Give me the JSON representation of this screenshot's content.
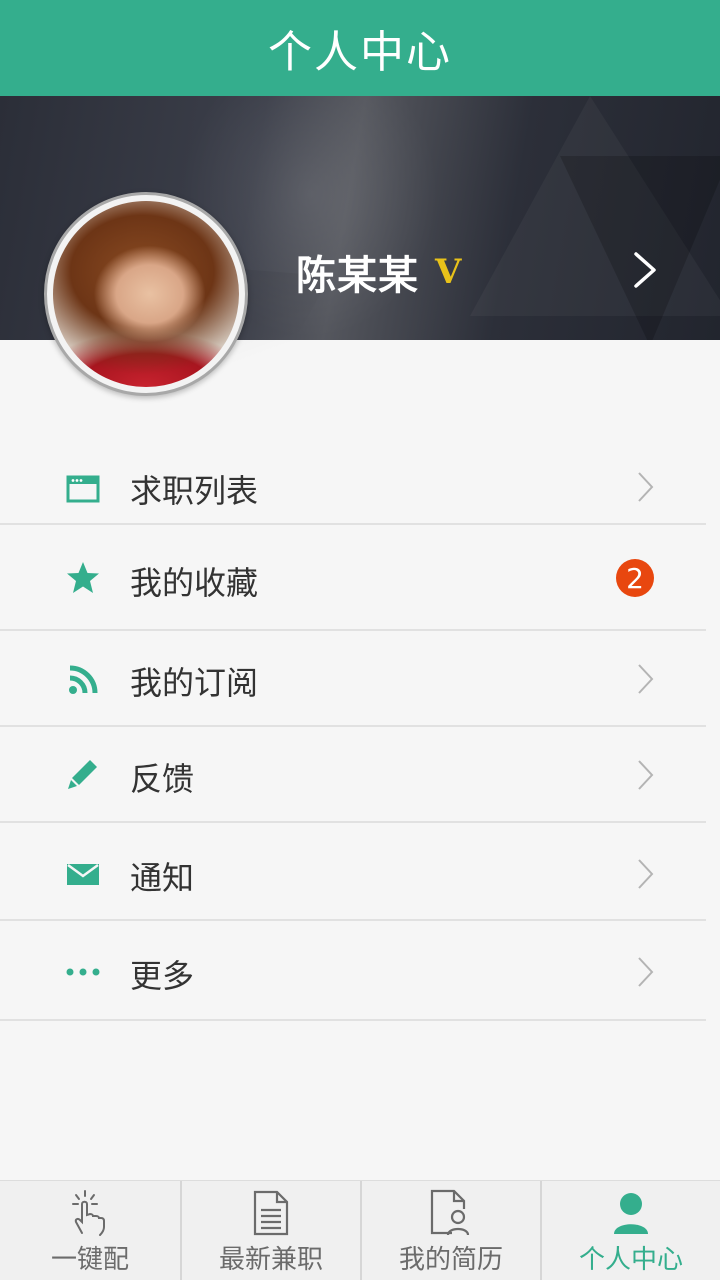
{
  "header": {
    "title": "个人中心"
  },
  "profile": {
    "name": "陈某某",
    "badge": "V"
  },
  "menu": [
    {
      "label": "求职列表",
      "icon": "window-icon"
    },
    {
      "label": "我的收藏",
      "icon": "star-icon",
      "badge_count": "2"
    },
    {
      "label": "我的订阅",
      "icon": "rss-icon"
    },
    {
      "label": "反馈",
      "icon": "pencil-icon"
    },
    {
      "label": "通知",
      "icon": "envelope-icon"
    },
    {
      "label": "更多",
      "icon": "more-dots-icon"
    }
  ],
  "tabs": [
    {
      "label": "一键配",
      "icon": "tap-hand-icon"
    },
    {
      "label": "最新兼职",
      "icon": "document-icon"
    },
    {
      "label": "我的简历",
      "icon": "resume-icon"
    },
    {
      "label": "个人中心",
      "icon": "person-icon",
      "active": true
    }
  ],
  "colors": {
    "accent": "#34ae8d",
    "badge": "#e8470f",
    "vip": "#e8c21a"
  }
}
